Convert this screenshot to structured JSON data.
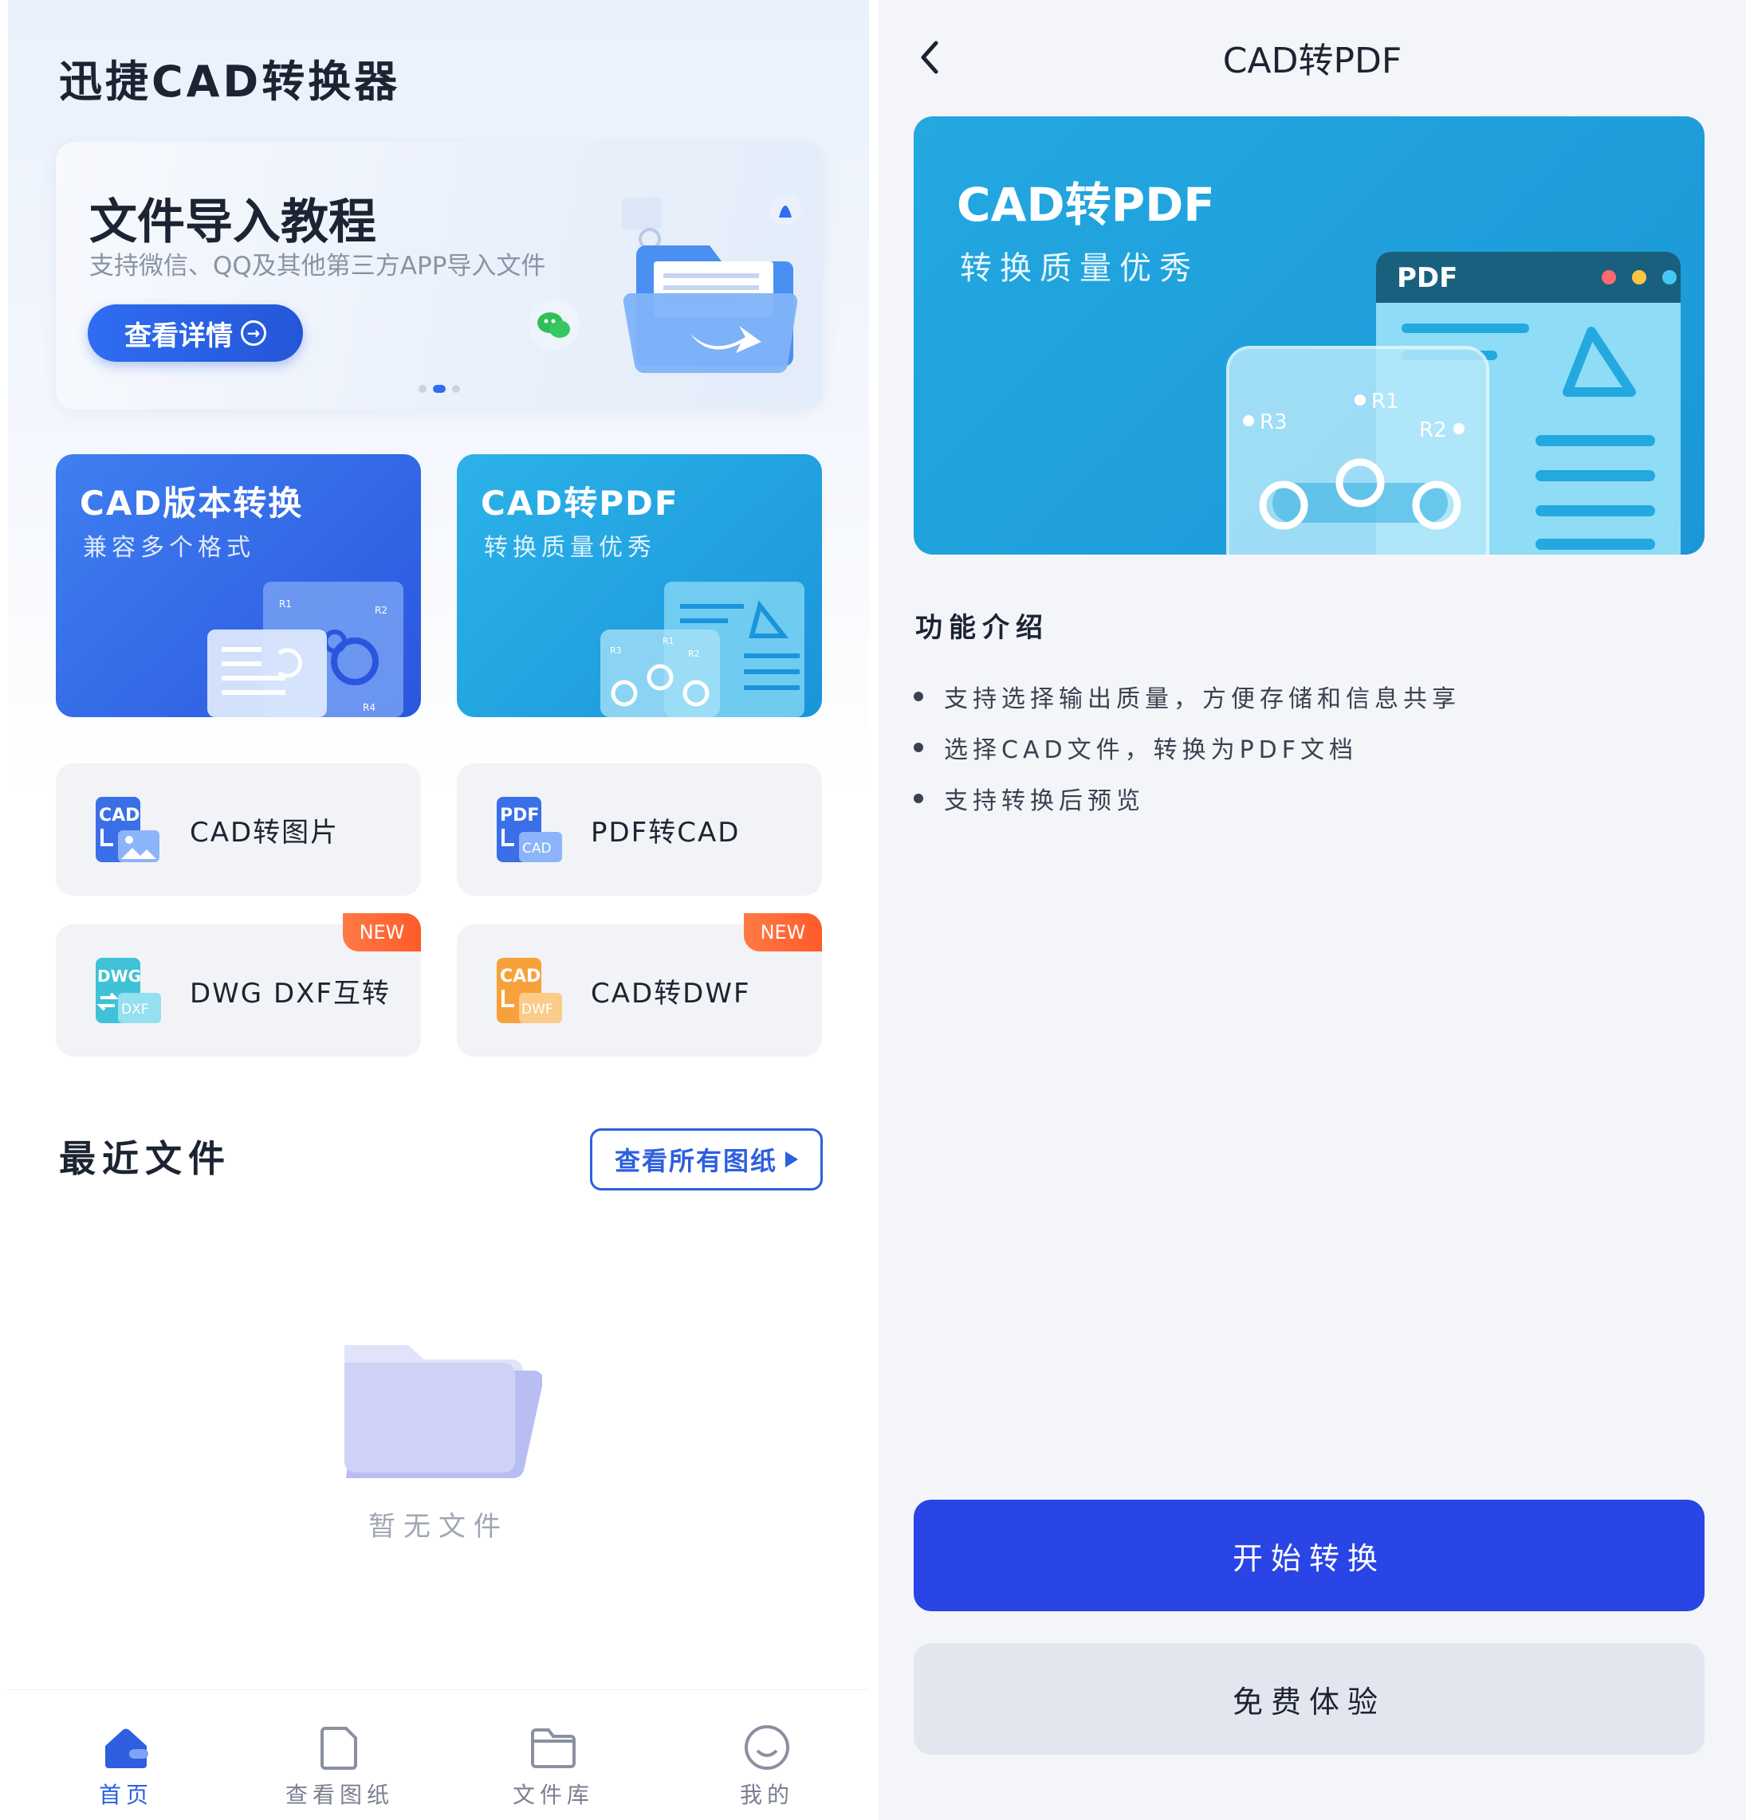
{
  "home": {
    "app_title": "迅捷CAD转换器",
    "banner": {
      "title": "文件导入教程",
      "subtitle": "支持微信、QQ及其他第三方APP导入文件",
      "button_label": "查看详情",
      "page_index": 2,
      "page_count": 3
    },
    "feature_cards": [
      {
        "title": "CAD版本转换",
        "subtitle": "兼容多个格式",
        "icon": "cad-version-illustration"
      },
      {
        "title": "CAD转PDF",
        "subtitle": "转换质量优秀",
        "icon": "cad-to-pdf-illustration"
      }
    ],
    "tools": [
      {
        "label": "CAD转图片",
        "icon": "cad-to-image-icon",
        "icon_top": "CAD",
        "badge": ""
      },
      {
        "label": "PDF转CAD",
        "icon": "pdf-to-cad-icon",
        "icon_top": "PDF",
        "icon_bottom": "CAD",
        "badge": ""
      },
      {
        "label": "DWG DXF互转",
        "icon": "dwg-dxf-icon",
        "icon_top": "DWG",
        "icon_bottom": "DXF",
        "badge": "NEW"
      },
      {
        "label": "CAD转DWF",
        "icon": "cad-to-dwf-icon",
        "icon_top": "CAD",
        "icon_bottom": "DWF",
        "badge": "NEW"
      }
    ],
    "recent": {
      "title": "最近文件",
      "view_all_label": "查看所有图纸",
      "empty_text": "暂无文件"
    },
    "tabs": [
      {
        "label": "首页",
        "icon": "home-icon",
        "active": true
      },
      {
        "label": "查看图纸",
        "icon": "drawing-icon",
        "active": false
      },
      {
        "label": "文件库",
        "icon": "folder-icon",
        "active": false
      },
      {
        "label": "我的",
        "icon": "profile-icon",
        "active": false
      }
    ]
  },
  "detail": {
    "page_title": "CAD转PDF",
    "hero": {
      "title": "CAD转PDF",
      "subtitle": "转换质量优秀",
      "window_label": "PDF",
      "labels": [
        "R1",
        "R2",
        "R3"
      ]
    },
    "intro_title": "功能介绍",
    "intro_items": [
      "支持选择输出质量，方便存储和信息共享",
      "选择CAD文件，转换为PDF文档",
      "支持转换后预览"
    ],
    "primary_button": "开始转换",
    "secondary_button": "免费体验"
  },
  "colors": {
    "primary": "#2a45e6",
    "accent_blue": "#2f6df2",
    "feature_version": "#2a56df",
    "feature_pdf": "#1a95db",
    "badge_new": "#ff5a2a"
  }
}
